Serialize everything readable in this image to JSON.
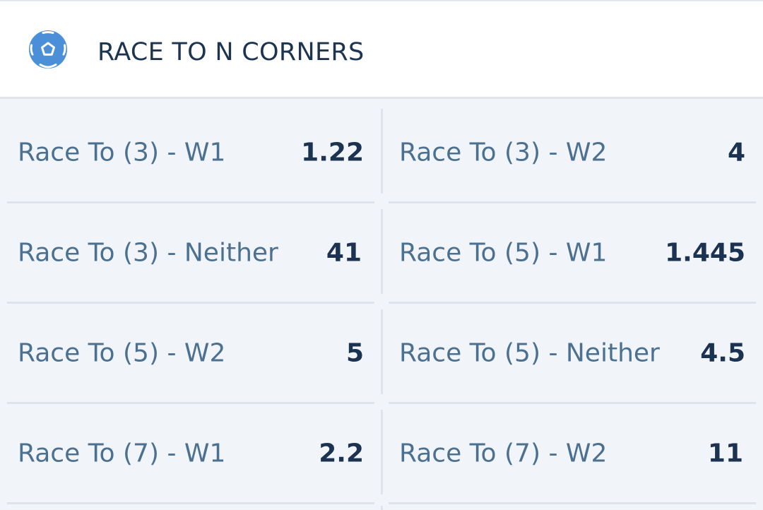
{
  "market": {
    "title": "RACE TO N CORNERS",
    "icon": "soccer-ball-icon",
    "accent_color": "#4a90d9"
  },
  "outcomes": [
    {
      "label": "Race To (3) - W1",
      "odds": "1.22"
    },
    {
      "label": "Race To (3) - W2",
      "odds": "4"
    },
    {
      "label": "Race To (3) - Neither",
      "odds": "41"
    },
    {
      "label": "Race To (5) - W1",
      "odds": "1.445"
    },
    {
      "label": "Race To (5) - W2",
      "odds": "5"
    },
    {
      "label": "Race To (5) - Neither",
      "odds": "4.5"
    },
    {
      "label": "Race To (7) - W1",
      "odds": "2.2"
    },
    {
      "label": "Race To (7) - W2",
      "odds": "11"
    }
  ]
}
